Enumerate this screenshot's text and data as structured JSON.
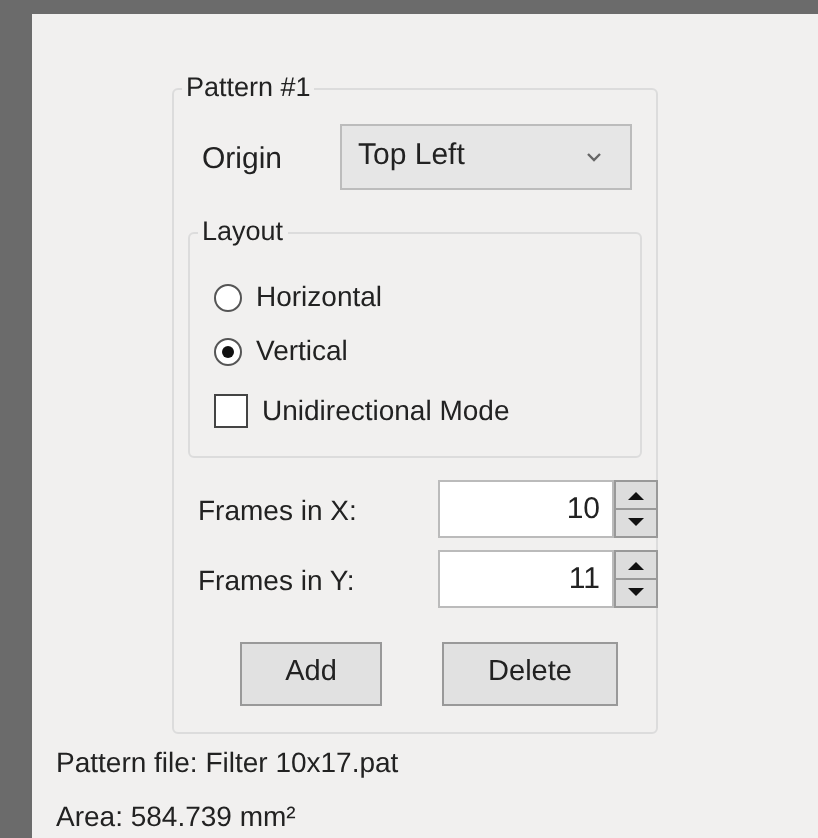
{
  "group": {
    "title": "Pattern #1",
    "origin": {
      "label": "Origin",
      "value": "Top Left"
    },
    "layout": {
      "title": "Layout",
      "options": [
        {
          "label": "Horizontal",
          "selected": false
        },
        {
          "label": "Vertical",
          "selected": true
        }
      ],
      "unidirectional": {
        "label": "Unidirectional Mode",
        "checked": false
      }
    },
    "spinners": [
      {
        "label": "Frames in X:",
        "value": "10"
      },
      {
        "label": "Frames in Y:",
        "value": "11"
      }
    ],
    "buttons": [
      "Add",
      "Delete"
    ]
  },
  "info": [
    "Pattern file: Filter 10x17.pat",
    "Area: 584.739 mm²"
  ]
}
